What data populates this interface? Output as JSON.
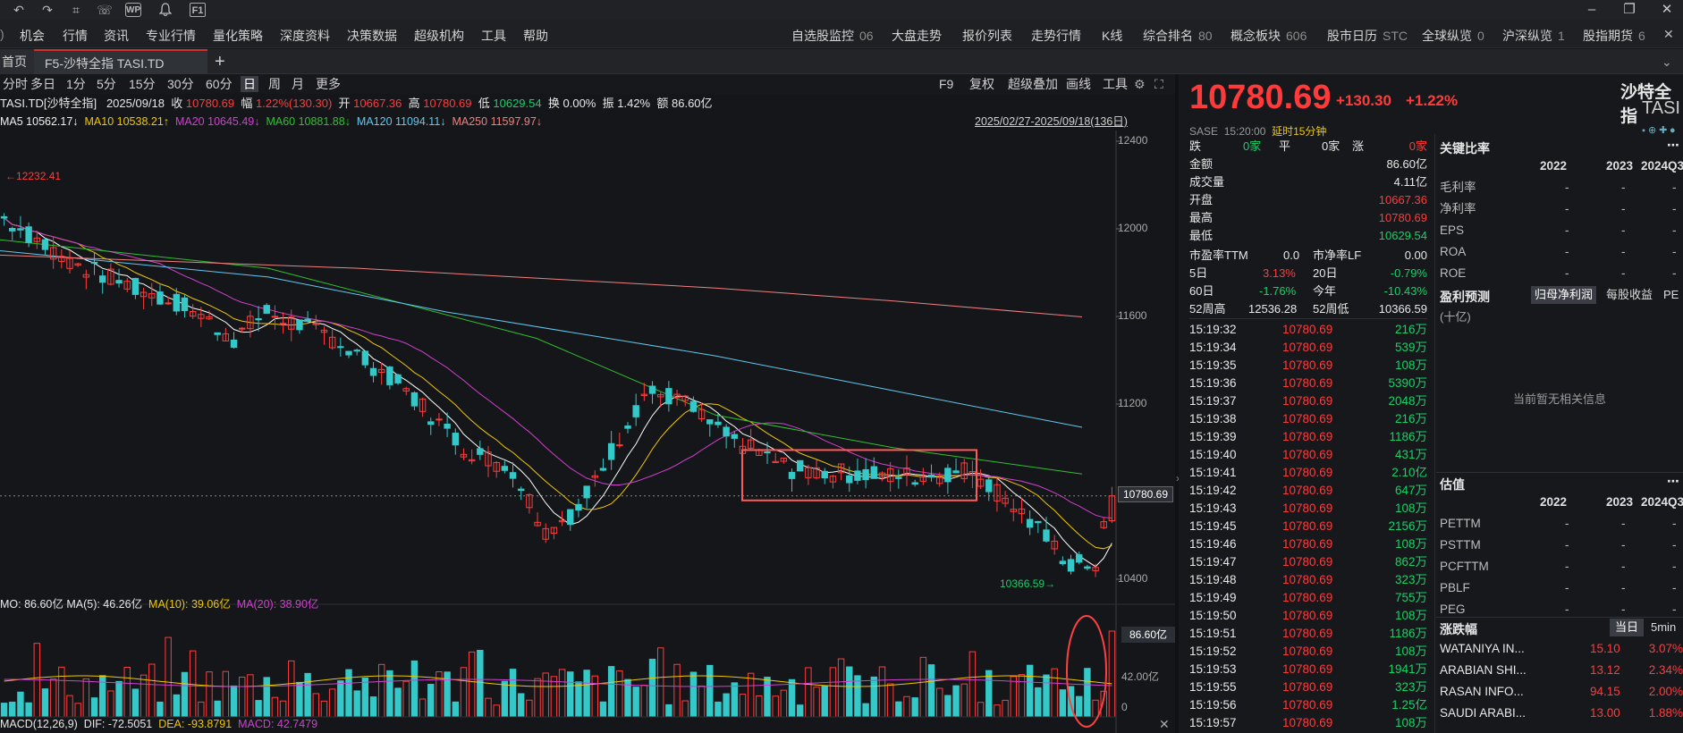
{
  "titlebar": {
    "icons": [
      "undo-icon",
      "redo-icon",
      "crop-icon",
      "chat-icon",
      "wp-icon",
      "bell-icon",
      "f1-icon"
    ],
    "icon_glyphs": [
      "↶",
      "↷",
      "⌗",
      "☏",
      "WP",
      "🔔",
      "F1"
    ],
    "win_buttons": [
      "–",
      "❐",
      "✕"
    ]
  },
  "menu": {
    "left_items": [
      "机会",
      "行情",
      "资讯",
      "专业行情",
      "量化策略",
      "深度资料",
      "决策数据",
      "超级机构",
      "工具",
      "帮助"
    ],
    "right_items": [
      {
        "label": "自选股监控",
        "count": "06"
      },
      {
        "label": "大盘走势",
        "count": ""
      },
      {
        "label": "报价列表",
        "count": ""
      },
      {
        "label": "走势行情",
        "count": ""
      },
      {
        "label": "K线",
        "count": ""
      },
      {
        "label": "综合排名",
        "count": "80"
      },
      {
        "label": "概念板块",
        "count": "606"
      },
      {
        "label": "股市日历",
        "count": "STC"
      },
      {
        "label": "全球纵览",
        "count": "0"
      },
      {
        "label": "沪深纵览",
        "count": "1"
      },
      {
        "label": "股指期货",
        "count": "6"
      }
    ],
    "close_glyph": "✕"
  },
  "tabs": {
    "home": "首页",
    "active": "F5-沙特全指 TASI.TD",
    "add": "+"
  },
  "toolbar": {
    "periods": [
      "分时",
      "多日",
      "1分",
      "5分",
      "15分",
      "30分",
      "60分",
      "日",
      "周",
      "月",
      "更多"
    ],
    "active_period": "日",
    "right_tools": [
      "F9",
      "复权",
      "超级叠加",
      "画线",
      "工具"
    ]
  },
  "info": {
    "code": "TASI.TD[沙特全指]",
    "date": "2025/09/18",
    "close_label": "收",
    "close": "10780.69",
    "range_label": "幅",
    "range": "1.22%(130.30)",
    "open_label": "开",
    "open": "10667.36",
    "high_label": "高",
    "high": "10780.69",
    "low_label": "低",
    "low": "10629.54",
    "turnover_label": "换",
    "turnover": "0.00%",
    "amp_label": "振",
    "amp": "1.42%",
    "amount_label": "额",
    "amount": "86.60亿"
  },
  "ma_line": {
    "ma5": "MA5 10562.17↓",
    "ma10": "MA10 10538.21↑",
    "ma20": "MA20 10645.49↓",
    "ma60": "MA60 10881.88↓",
    "ma120": "MA120 11094.11↓",
    "ma250": "MA250 11597.97↓",
    "range": "2025/02/27-2025/09/18(136日)"
  },
  "chart": {
    "y_labels": [
      "12400",
      "12000",
      "11600",
      "11200",
      "10400"
    ],
    "y_values": [
      12400,
      12000,
      11600,
      11200,
      10400
    ],
    "price_tag": "10780.69",
    "high_mark": "12232.41",
    "low_mark": "10366.59",
    "ma_colors": {
      "ma5": "#ffffff",
      "ma10": "#f0c800",
      "ma20": "#d040d0",
      "ma60": "#30c030",
      "ma120": "#60c8f0",
      "ma250": "#f08080"
    },
    "up_color": "#ff3c3c",
    "down_color": "#34c8c8"
  },
  "volume": {
    "header": "MO: 86.60亿  MA(5): 46.26亿",
    "ma10": "MA(10): 39.06亿",
    "ma20": "MA(20): 38.90亿",
    "labels": [
      "86.60亿",
      "42.00亿",
      "0"
    ]
  },
  "macd": {
    "label": "MACD(12,26,9)",
    "dif": "DIF: -72.5051",
    "dea": "DEA: -93.8791",
    "macd": "MACD: 42.7479"
  },
  "quote": {
    "price": "10780.69",
    "change": "+130.30",
    "change_pct": "+1.22%",
    "name": "沙特全指",
    "code": "TASI",
    "exchange": "SASE",
    "time": "15:20:00",
    "delay": "延时15分钟",
    "fall_label": "跌",
    "fall_count": "0家",
    "flat_label": "平",
    "flat_count": "0家",
    "rise_label": "涨",
    "rise_count": "0家",
    "stats": [
      {
        "label": "金额",
        "value": "86.60亿",
        "color": "white"
      },
      {
        "label": "成交量",
        "value": "4.11亿",
        "color": "white"
      },
      {
        "label": "开盘",
        "value": "10667.36",
        "color": "red"
      },
      {
        "label": "最高",
        "value": "10780.69",
        "color": "red"
      },
      {
        "label": "最低",
        "value": "10629.54",
        "color": "green"
      }
    ],
    "pe_label": "市盈率TTM",
    "pe_value": "0.0",
    "pb_label": "市净率LF",
    "pb_value": "0.00",
    "d5_label": "5日",
    "d5_value": "3.13%",
    "d20_label": "20日",
    "d20_value": "-0.79%",
    "d60_label": "60日",
    "d60_value": "-1.76%",
    "ytd_label": "今年",
    "ytd_value": "-10.43%",
    "w52h_label": "52周高",
    "w52h_value": "12536.28",
    "w52l_label": "52周低",
    "w52l_value": "10366.59"
  },
  "trades": [
    {
      "t": "15:19:32",
      "p": "10780.69",
      "v": "216万"
    },
    {
      "t": "15:19:34",
      "p": "10780.69",
      "v": "539万"
    },
    {
      "t": "15:19:35",
      "p": "10780.69",
      "v": "108万"
    },
    {
      "t": "15:19:36",
      "p": "10780.69",
      "v": "5390万"
    },
    {
      "t": "15:19:37",
      "p": "10780.69",
      "v": "2048万"
    },
    {
      "t": "15:19:38",
      "p": "10780.69",
      "v": "216万"
    },
    {
      "t": "15:19:39",
      "p": "10780.69",
      "v": "1186万"
    },
    {
      "t": "15:19:40",
      "p": "10780.69",
      "v": "431万"
    },
    {
      "t": "15:19:41",
      "p": "10780.69",
      "v": "2.10亿"
    },
    {
      "t": "15:19:42",
      "p": "10780.69",
      "v": "647万"
    },
    {
      "t": "15:19:43",
      "p": "10780.69",
      "v": "108万"
    },
    {
      "t": "15:19:45",
      "p": "10780.69",
      "v": "2156万"
    },
    {
      "t": "15:19:46",
      "p": "10780.69",
      "v": "108万"
    },
    {
      "t": "15:19:47",
      "p": "10780.69",
      "v": "862万"
    },
    {
      "t": "15:19:48",
      "p": "10780.69",
      "v": "323万"
    },
    {
      "t": "15:19:49",
      "p": "10780.69",
      "v": "755万"
    },
    {
      "t": "15:19:50",
      "p": "10780.69",
      "v": "108万"
    },
    {
      "t": "15:19:51",
      "p": "10780.69",
      "v": "1186万"
    },
    {
      "t": "15:19:52",
      "p": "10780.69",
      "v": "108万"
    },
    {
      "t": "15:19:53",
      "p": "10780.69",
      "v": "1941万"
    },
    {
      "t": "15:19:55",
      "p": "10780.69",
      "v": "323万"
    },
    {
      "t": "15:19:56",
      "p": "10780.69",
      "v": "1.25亿"
    },
    {
      "t": "15:19:57",
      "p": "10780.69",
      "v": "108万"
    }
  ],
  "ratios": {
    "title": "关键比率",
    "years": [
      "2022",
      "2023",
      "2024Q3"
    ],
    "rows": [
      {
        "label": "毛利率",
        "vals": [
          "-",
          "-",
          "-"
        ]
      },
      {
        "label": "净利率",
        "vals": [
          "-",
          "-",
          "-"
        ]
      },
      {
        "label": "EPS",
        "vals": [
          "-",
          "-",
          "-"
        ]
      },
      {
        "label": "ROA",
        "vals": [
          "-",
          "-",
          "-"
        ]
      },
      {
        "label": "ROE",
        "vals": [
          "-",
          "-",
          "-"
        ]
      }
    ]
  },
  "forecast": {
    "title": "盈利预测",
    "tab1": "归母净利润",
    "tab2": "每股收益",
    "tab3": "PE",
    "unit": "(十亿)",
    "empty": "当前暂无相关信息"
  },
  "valuation": {
    "title": "估值",
    "years": [
      "2022",
      "2023",
      "2024Q3"
    ],
    "rows": [
      {
        "label": "PETTM",
        "vals": [
          "-",
          "-",
          "-"
        ]
      },
      {
        "label": "PSTTM",
        "vals": [
          "-",
          "-",
          "-"
        ]
      },
      {
        "label": "PCFTTM",
        "vals": [
          "-",
          "-",
          "-"
        ]
      },
      {
        "label": "PBLF",
        "vals": [
          "-",
          "-",
          "-"
        ]
      },
      {
        "label": "PEG",
        "vals": [
          "-",
          "-",
          "-"
        ]
      }
    ]
  },
  "movers": {
    "title": "涨跌幅",
    "tab1": "当日",
    "tab2": "5min",
    "rows": [
      {
        "name": "WATANIYA IN...",
        "price": "15.10",
        "pct": "3.07%"
      },
      {
        "name": "ARABIAN SHI...",
        "price": "13.12",
        "pct": "2.34%"
      },
      {
        "name": "RASAN INFO...",
        "price": "94.15",
        "pct": "2.00%"
      },
      {
        "name": "SAUDI ARABI...",
        "price": "13.00",
        "pct": "1.88%"
      }
    ]
  }
}
